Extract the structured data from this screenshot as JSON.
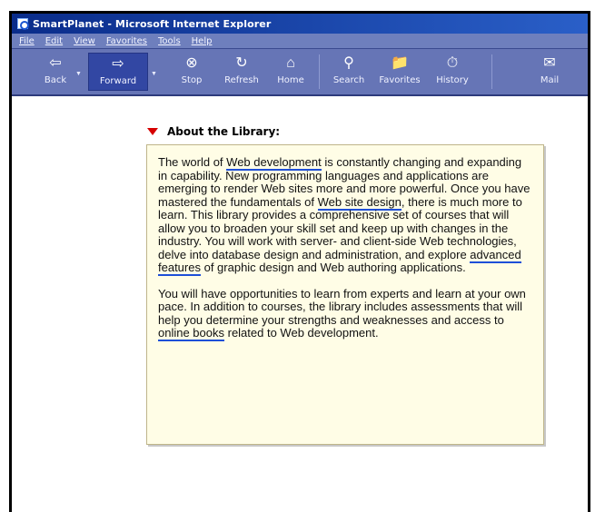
{
  "window": {
    "title": "SmartPlanet - Microsoft Internet Explorer"
  },
  "menu": {
    "items": [
      "File",
      "Edit",
      "View",
      "Favorites",
      "Tools",
      "Help"
    ]
  },
  "toolbar": {
    "buttons": [
      {
        "label": "Back",
        "icon": "back-arrow-icon"
      },
      {
        "label": "Forward",
        "icon": "forward-arrow-icon",
        "state": "pressed"
      },
      {
        "label": "Stop",
        "icon": "stop-icon"
      },
      {
        "label": "Refresh",
        "icon": "refresh-icon"
      },
      {
        "label": "Home",
        "icon": "home-icon"
      },
      {
        "label": "Search",
        "icon": "search-icon"
      },
      {
        "label": "Favorites",
        "icon": "favorites-icon"
      },
      {
        "label": "History",
        "icon": "history-icon"
      },
      {
        "label": "Mail",
        "icon": "mail-icon"
      }
    ]
  },
  "section": {
    "heading": "About the Library:",
    "heading_icon": "red-triangle-icon",
    "heading_icon_color": "#d60000"
  },
  "body": {
    "p1": {
      "t1": "The world of ",
      "link1": "Web development",
      "t2": " is constantly changing and expanding in capability. New programming languages and applications are emerging to render Web sites more and more powerful. Once you have mastered the fundamentals of ",
      "link2": "Web site design",
      "t3": ", there is much more to learn. This library provides a comprehensive set of courses that will allow you to broaden your skill set and keep up with changes in the industry. You will work with server- and client-side Web technologies, delve into database design and administration, and explore ",
      "link3": "advanced features",
      "t4": " of graphic design and Web authoring applications."
    },
    "p2": {
      "t1": "You will have opportunities to learn from experts and learn at your own pace. In addition to courses, the library includes assessments that will help you determine your strengths and weaknesses and access to ",
      "link1": "online books",
      "t2": " related to Web development."
    }
  },
  "colors": {
    "title_bar": "#0a2c8a",
    "toolbar": "#6675b6",
    "content_background": "#fffde6",
    "link_underline": "#1e4fd8"
  }
}
